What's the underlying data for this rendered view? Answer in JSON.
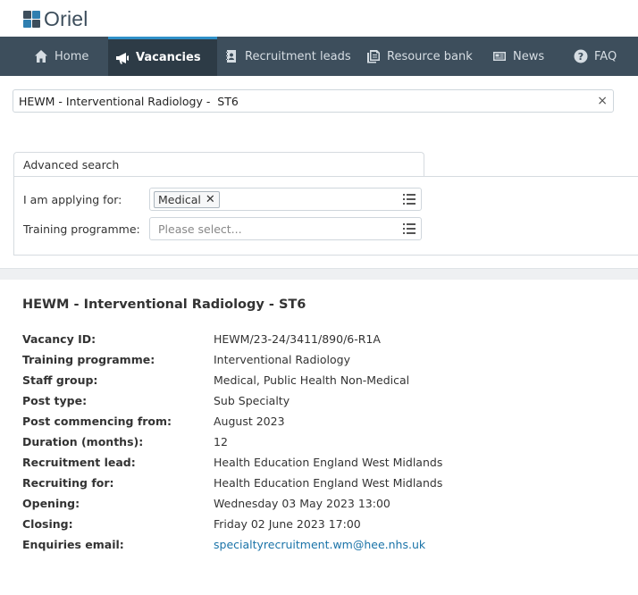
{
  "brand": {
    "name": "Oriel"
  },
  "nav": {
    "items": [
      {
        "label": "Home",
        "icon": "home-icon",
        "active": false
      },
      {
        "label": "Vacancies",
        "icon": "megaphone-icon",
        "active": true
      },
      {
        "label": "Recruitment leads",
        "icon": "contact-book-icon",
        "active": false
      },
      {
        "label": "Resource bank",
        "icon": "documents-icon",
        "active": false
      },
      {
        "label": "News",
        "icon": "newspaper-icon",
        "active": false
      },
      {
        "label": "FAQ",
        "icon": "question-icon",
        "active": false
      }
    ]
  },
  "search": {
    "value": "HEWM - Interventional Radiology -  ST6",
    "clear_icon": "×"
  },
  "advanced": {
    "title": "Advanced search",
    "applying_label": "I am applying for:",
    "applying_tag": "Medical",
    "programme_label": "Training programme:",
    "programme_placeholder": "Please select..."
  },
  "vacancy": {
    "title": "HEWM - Interventional Radiology - ST6",
    "rows": [
      {
        "label": "Vacancy ID:",
        "value": "HEWM/23-24/3411/890/6-R1A"
      },
      {
        "label": "Training programme:",
        "value": "Interventional Radiology"
      },
      {
        "label": "Staff group:",
        "value": "Medical, Public Health Non-Medical"
      },
      {
        "label": "Post type:",
        "value": "Sub Specialty"
      },
      {
        "label": "Post commencing from:",
        "value": "August 2023"
      },
      {
        "label": "Duration (months):",
        "value": "12"
      },
      {
        "label": "Recruitment lead:",
        "value": "Health Education England West Midlands"
      },
      {
        "label": "Recruiting for:",
        "value": "Health Education England West Midlands"
      },
      {
        "label": "Opening:",
        "value": "Wednesday 03 May 2023 13:00"
      },
      {
        "label": "Closing:",
        "value": "Friday 02 June 2023 17:00"
      },
      {
        "label": "Enquiries email:",
        "value": "specialtyrecruitment.wm@hee.nhs.uk"
      }
    ]
  },
  "colors": {
    "nav_bg": "#3d4e5c",
    "nav_active": "#2d3b46",
    "accent": "#2f90c8",
    "link": "#1a73a8"
  }
}
